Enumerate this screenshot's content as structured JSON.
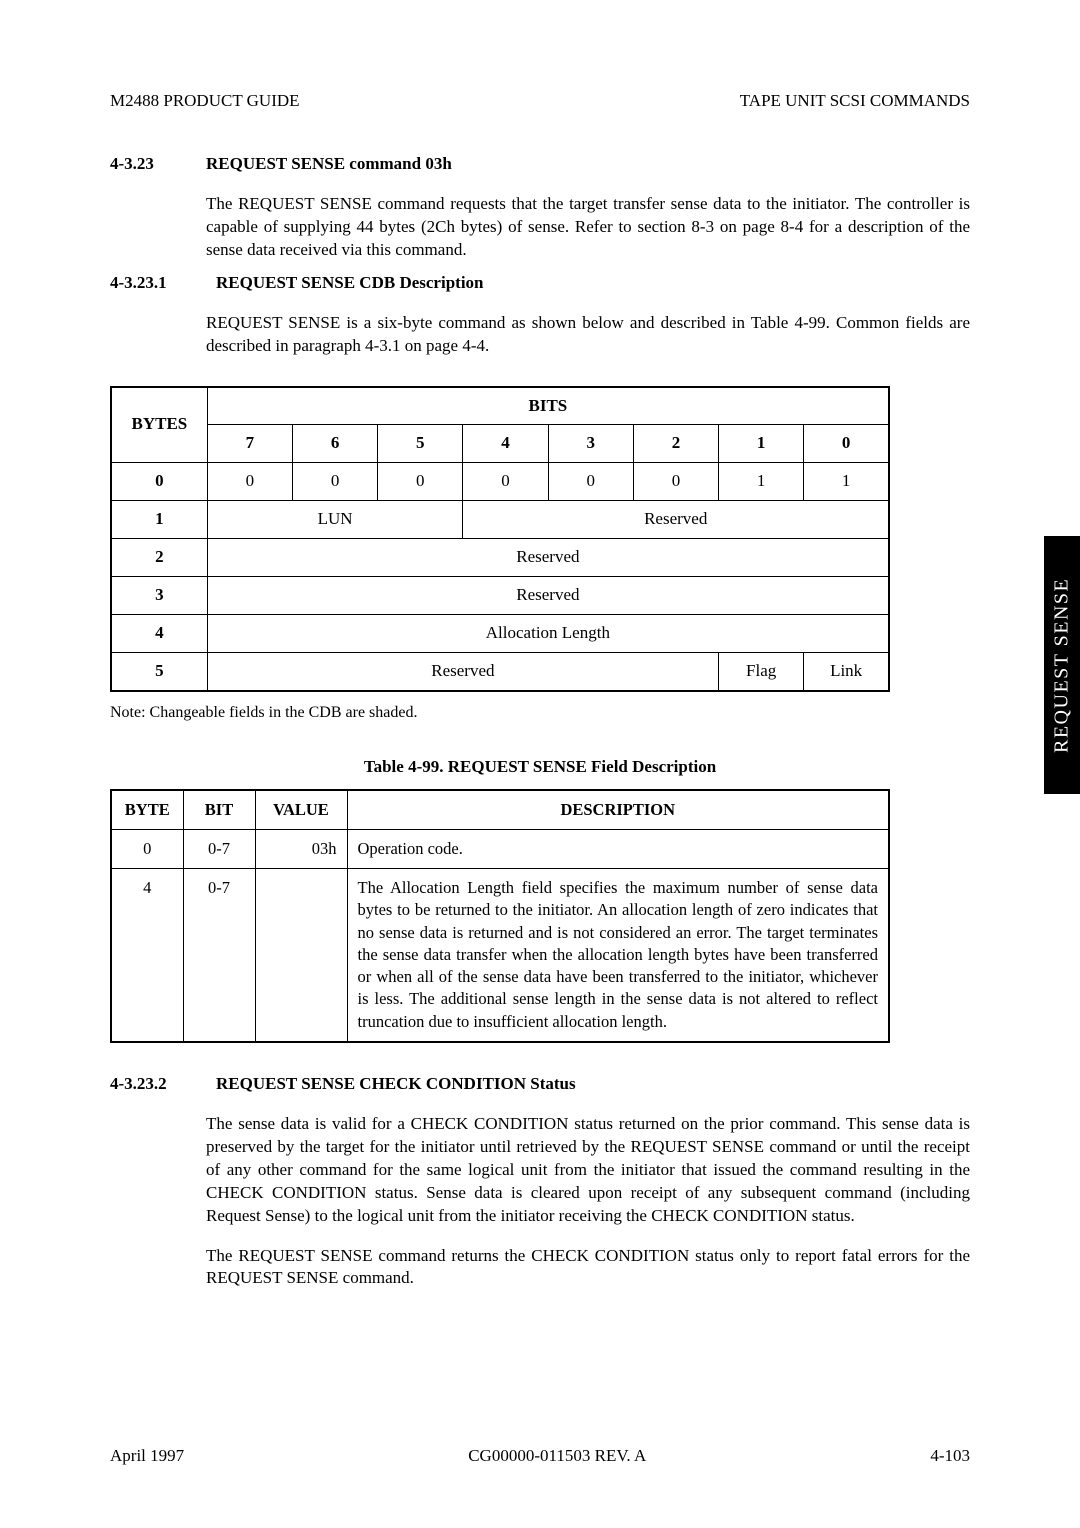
{
  "header": {
    "left": "M2488 PRODUCT GUIDE",
    "right": "TAPE UNIT SCSI COMMANDS"
  },
  "side_tab": "REQUEST SENSE",
  "sec1": {
    "num": "4-3.23",
    "title": "REQUEST SENSE command 03h",
    "p1": "The REQUEST SENSE command requests that the target transfer sense data to the initiator. The controller is capable of supplying 44 bytes (2Ch bytes) of sense. Refer to section 8-3 on page 8-4 for a description of the sense data received via this command."
  },
  "sec2": {
    "num": "4-3.23.1",
    "title": "REQUEST SENSE CDB Description",
    "p1": "REQUEST SENSE is a six-byte command as shown below and described in Table 4-99. Common fields are described in paragraph 4-3.1 on page 4-4."
  },
  "cdb_table": {
    "bits_label": "BITS",
    "bytes_label": "BYTES",
    "bit_headers": [
      "7",
      "6",
      "5",
      "4",
      "3",
      "2",
      "1",
      "0"
    ],
    "rows": [
      {
        "byte": "0",
        "cells": [
          "0",
          "0",
          "0",
          "0",
          "0",
          "0",
          "1",
          "1"
        ]
      },
      {
        "byte": "1",
        "lun": "LUN",
        "reserved": "Reserved"
      },
      {
        "byte": "2",
        "full": "Reserved"
      },
      {
        "byte": "3",
        "full": "Reserved"
      },
      {
        "byte": "4",
        "full": "Allocation Length"
      },
      {
        "byte": "5",
        "reserved6": "Reserved",
        "flag": "Flag",
        "link": "Link"
      }
    ],
    "note": "Note: Changeable fields in the CDB are shaded."
  },
  "desc_table": {
    "caption": "Table 4-99.  REQUEST SENSE Field Description",
    "headers": {
      "byte": "BYTE",
      "bit": "BIT",
      "value": "VALUE",
      "desc": "DESCRIPTION"
    },
    "rows": [
      {
        "byte": "0",
        "bit": "0-7",
        "value": "03h",
        "desc": "Operation code."
      },
      {
        "byte": "4",
        "bit": "0-7",
        "value": "",
        "desc": "The Allocation Length field specifies the maximum number of sense data bytes to be returned to the initiator.  An allocation length of zero indicates that no sense data is returned and is not considered an error.  The target terminates the sense data transfer when the allocation length bytes have been transferred or when all of the sense data have been transferred to the initiator, whichever is less.  The additional sense length in the sense data is not altered to reflect truncation due to insufficient allocation length."
      }
    ]
  },
  "sec3": {
    "num": "4-3.23.2",
    "title": "REQUEST SENSE CHECK CONDITION Status",
    "p1": "The sense data is valid for a CHECK CONDITION status returned on the prior command. This sense data is preserved by the target for the initiator until retrieved by the REQUEST SENSE command or until the receipt of any other command for the same logical unit from the initiator that issued the command resulting in the CHECK CONDITION status. Sense data is cleared upon receipt of any subsequent command (including Request Sense) to the logical unit from the initiator receiving the CHECK CONDITION status.",
    "p2": "The REQUEST SENSE command returns the CHECK CONDITION status only to report fatal errors for the REQUEST SENSE command."
  },
  "footer": {
    "left": "April 1997",
    "center": "CG00000-011503 REV. A",
    "right": "4-103"
  }
}
